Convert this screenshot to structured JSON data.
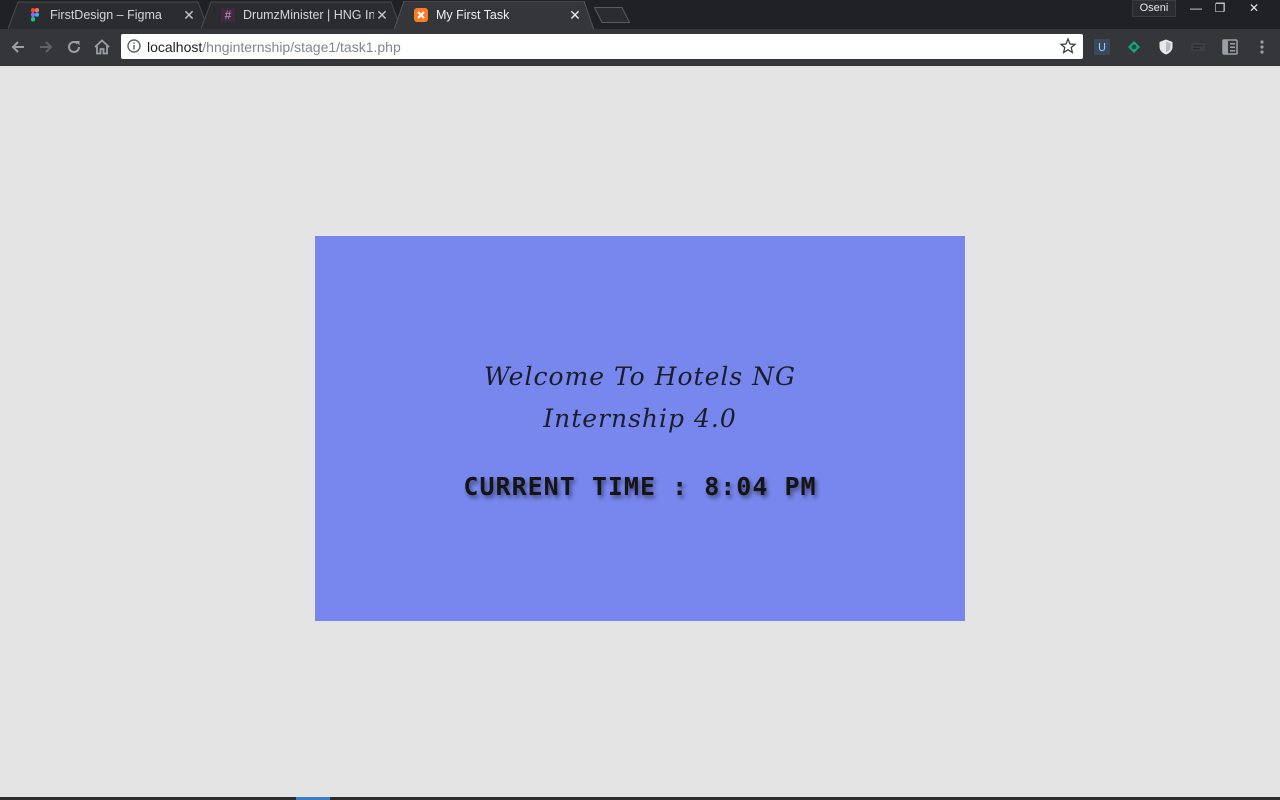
{
  "tabs": [
    {
      "title": "FirstDesign – Figma",
      "icon": "figma-icon",
      "active": false
    },
    {
      "title": "DrumzMinister | HNG Int",
      "icon": "slack-hash-icon",
      "active": false
    },
    {
      "title": "My First Task",
      "icon": "xampp-icon",
      "active": true
    }
  ],
  "profile_name": "Oseni",
  "window_controls": {
    "minimize": "—",
    "restore": "❐",
    "close": "✕"
  },
  "address": {
    "host": "localhost",
    "path": "/hnginternship/stage1/task1.php"
  },
  "page": {
    "welcome_line1": "Welcome To Hotels NG",
    "welcome_line2": "Internship 4.0",
    "time_text": "CURRENT TIME : 8:04 PM"
  },
  "colors": {
    "page_background": "#e4e4e4",
    "card_background": "#7887ee",
    "browser_frame": "#202124",
    "toolbar": "#35363a"
  }
}
